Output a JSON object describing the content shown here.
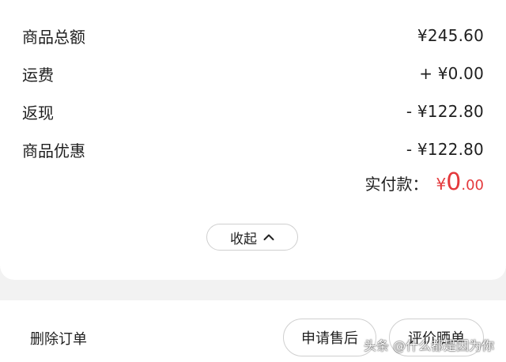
{
  "summary": {
    "rows": [
      {
        "label": "商品总额",
        "value": "¥245.60"
      },
      {
        "label": "运费",
        "value": "+ ¥0.00"
      },
      {
        "label": "返现",
        "value": "- ¥122.80"
      },
      {
        "label": "商品优惠",
        "value": "- ¥122.80"
      }
    ],
    "paid_label": "实付款：",
    "paid_currency": "¥",
    "paid_int": "0",
    "paid_dec": ".00",
    "collapse_label": "收起"
  },
  "actions": {
    "delete_label": "删除订单",
    "after_sales_label": "申请售后",
    "review_label": "评价晒单"
  },
  "watermark": "头条 @什么都是因为你",
  "colors": {
    "accent": "#e4393c",
    "background": "#f2f2f2"
  }
}
